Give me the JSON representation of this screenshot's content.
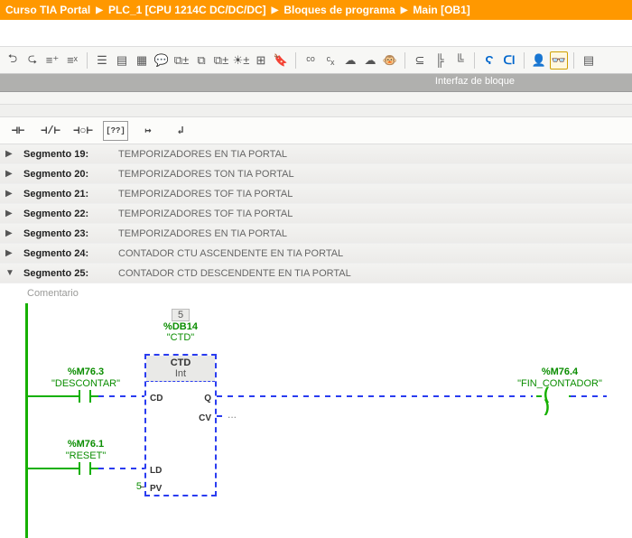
{
  "breadcrumb": {
    "p1": "Curso TIA Portal",
    "p2": "PLC_1 [CPU 1214C DC/DC/DC]",
    "p3": "Bloques de programa",
    "p4": "Main [OB1]"
  },
  "interface_label": "Interfaz de bloque",
  "palette": {
    "no_contact": "⊣⊢",
    "nc_contact": "⊣/⊢",
    "coil": "⊣○⊢",
    "box": "[??]",
    "branch_open": "↦",
    "branch_close": "↲"
  },
  "segments": [
    {
      "num": "Segmento 19:",
      "desc": "TEMPORIZADORES EN TIA PORTAL",
      "expanded": false
    },
    {
      "num": "Segmento 20:",
      "desc": "TEMPORIZADORES TON TIA PORTAL",
      "expanded": false
    },
    {
      "num": "Segmento 21:",
      "desc": "TEMPORIZADORES TOF TIA PORTAL",
      "expanded": false
    },
    {
      "num": "Segmento 22:",
      "desc": "TEMPORIZADORES TOF TIA PORTAL",
      "expanded": false
    },
    {
      "num": "Segmento 23:",
      "desc": "TEMPORIZADORES EN TIA PORTAL",
      "expanded": false
    },
    {
      "num": "Segmento 24:",
      "desc": "CONTADOR CTU ASCENDENTE EN TIA PORTAL",
      "expanded": false
    },
    {
      "num": "Segmento 25:",
      "desc": "CONTADOR CTD DESCENDENTE EN TIA PORTAL",
      "expanded": true
    }
  ],
  "comment_placeholder": "Comentario",
  "network": {
    "fb_instance_num": "5",
    "fb_instance_db": "%DB14",
    "fb_instance_name": "\"CTD\"",
    "fb_type": "CTD",
    "fb_datatype": "Int",
    "pin_cd": "CD",
    "pin_ld": "LD",
    "pin_pv": "PV",
    "pin_q": "Q",
    "pin_cv": "CV",
    "pv_value": "5",
    "cv_value": "...",
    "input_cd_addr": "%M76.3",
    "input_cd_sym": "\"DESCONTAR\"",
    "input_ld_addr": "%M76.1",
    "input_ld_sym": "\"RESET\"",
    "output_q_addr": "%M76.4",
    "output_q_sym": "\"FIN_CONTADOR\""
  }
}
